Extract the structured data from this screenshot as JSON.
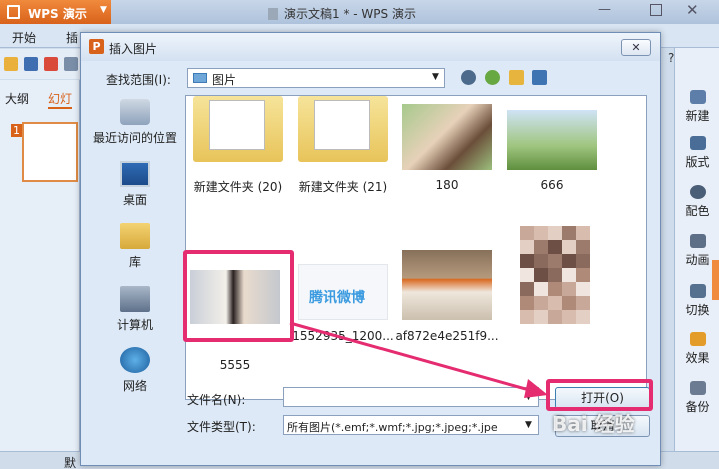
{
  "app": {
    "brand": "WPS 演示",
    "window_title": "演示文稿1 * - WPS 演示"
  },
  "menu_tabs": [
    "开始",
    "插"
  ],
  "left_panel": {
    "tab_outline": "大纲",
    "tab_slides": "幻灯",
    "slide_number": "1"
  },
  "status_bar": {
    "text": "默"
  },
  "task_pane": [
    {
      "label": "新建",
      "icon": "new-icon"
    },
    {
      "label": "版式",
      "icon": "layout-icon"
    },
    {
      "label": "配色",
      "icon": "palette-icon"
    },
    {
      "label": "动画",
      "icon": "animation-icon"
    },
    {
      "label": "切换",
      "icon": "transition-icon"
    },
    {
      "label": "效果",
      "icon": "effect-icon"
    },
    {
      "label": "备份",
      "icon": "backup-icon"
    }
  ],
  "dialog": {
    "title": "插入图片",
    "close_label": "✕",
    "look_in_label": "查找范围(I):",
    "look_in_value": "图片",
    "places": [
      {
        "label": "最近访问的位置",
        "icon": "recent-places-icon"
      },
      {
        "label": "桌面",
        "icon": "desktop-icon"
      },
      {
        "label": "库",
        "icon": "libraries-icon"
      },
      {
        "label": "计算机",
        "icon": "computer-icon"
      },
      {
        "label": "网络",
        "icon": "network-icon"
      }
    ],
    "files": [
      {
        "name": "新建文件夹 (20)",
        "kind": "folder"
      },
      {
        "name": "新建文件夹 (21)",
        "kind": "folder"
      },
      {
        "name": "180",
        "kind": "photo"
      },
      {
        "name": "666",
        "kind": "photo"
      },
      {
        "name": "5555",
        "kind": "photo"
      },
      {
        "name": "1552935_1200...",
        "kind": "photo"
      },
      {
        "name": "af872e4e251f9...",
        "kind": "photo"
      },
      {
        "name": "",
        "kind": "photo"
      }
    ],
    "thumb_text_tencent": "腾讯微博",
    "file_name_label": "文件名(N):",
    "file_name_value": "",
    "file_type_label": "文件类型(T):",
    "file_type_value": "所有图片(*.emf;*.wmf;*.jpg;*.jpeg;*.jpe",
    "open_label": "打开(O)",
    "cancel_label": "取消"
  },
  "watermark": "Bai 经验",
  "colors": {
    "accent": "#d9621b",
    "highlight": "#e52c70"
  }
}
